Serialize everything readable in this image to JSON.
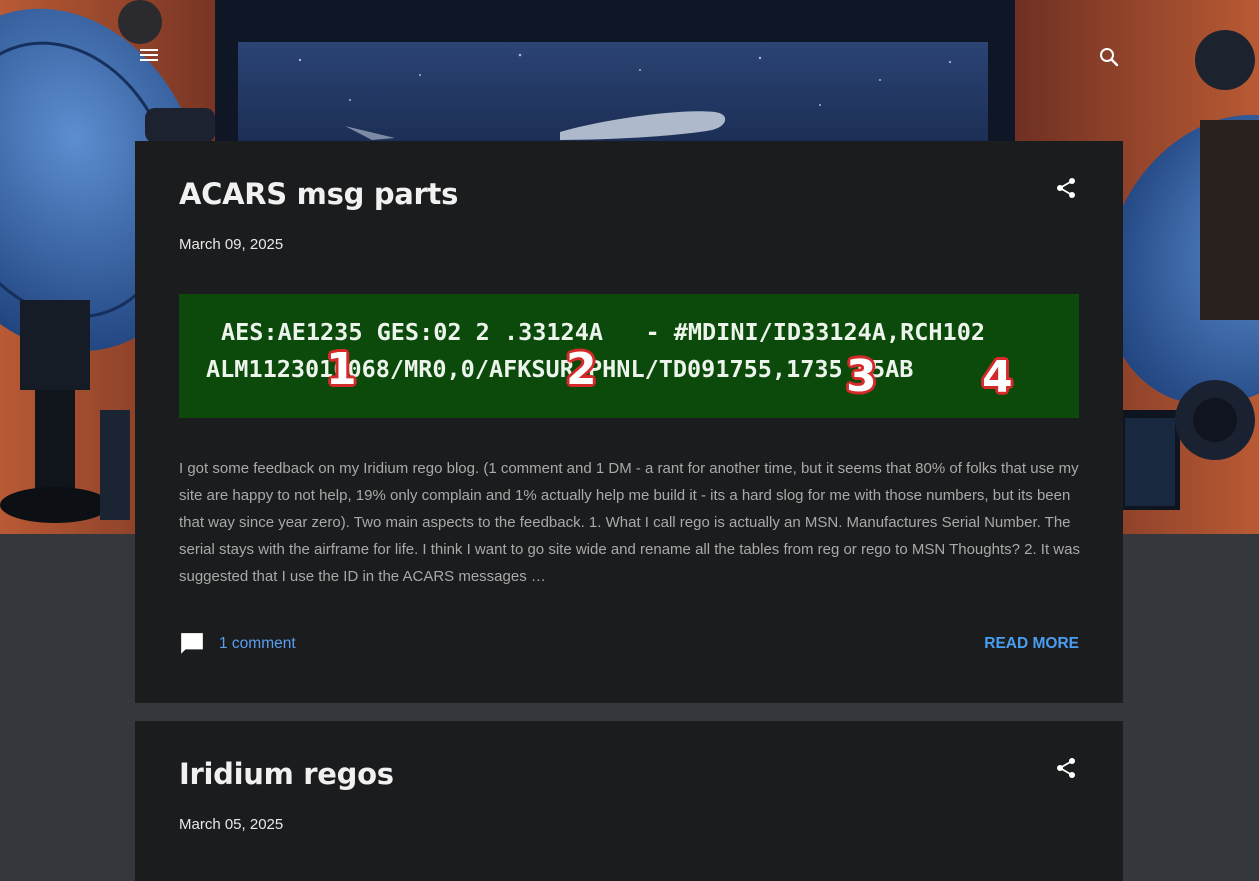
{
  "header": {
    "menu_icon": "hamburger-menu-icon",
    "search_icon": "search-icon"
  },
  "posts": [
    {
      "title": "ACARS msg parts",
      "date": "March 09, 2025",
      "share_icon": "share-icon",
      "image": {
        "line1": "AES:AE1235 GES:02 2 .33124A   - #MDINI/ID33124A,RCH102",
        "line2": "ALM1123010068/MR0,0/AFKSUR,PHNL/TD091755,1735 05AB",
        "markers": [
          "1",
          "2",
          "3",
          "4"
        ],
        "background": "#0b4a0b"
      },
      "snippet": "I got some feedback on my Iridium rego blog. (1 comment and 1 DM - a rant for another time, but it seems that 80% of folks that use my site are happy to not help, 19% only complain and 1% actually help me build it - its a hard slog for me with those numbers, but its been that way since year zero). Two main aspects to the feedback. 1. What I call rego is actually an MSN. Manufactures Serial Number. The serial stays with the airframe for life. I think I want to go site wide and rename all the tables from reg or rego to MSN Thoughts? 2. It was suggested that I use the ID in the ACARS messages",
      "ellipsis": "…",
      "comments_label": "1 comment",
      "comment_icon": "comment-icon",
      "read_more": "READ MORE"
    },
    {
      "title": "Iridium regos",
      "date": "March 05, 2025",
      "share_icon": "share-icon"
    }
  ],
  "colors": {
    "page_bg": "#34373b",
    "card_bg": "#1b1c1e",
    "accent": "#4a9ef0",
    "text_muted": "#a9a9a9"
  }
}
